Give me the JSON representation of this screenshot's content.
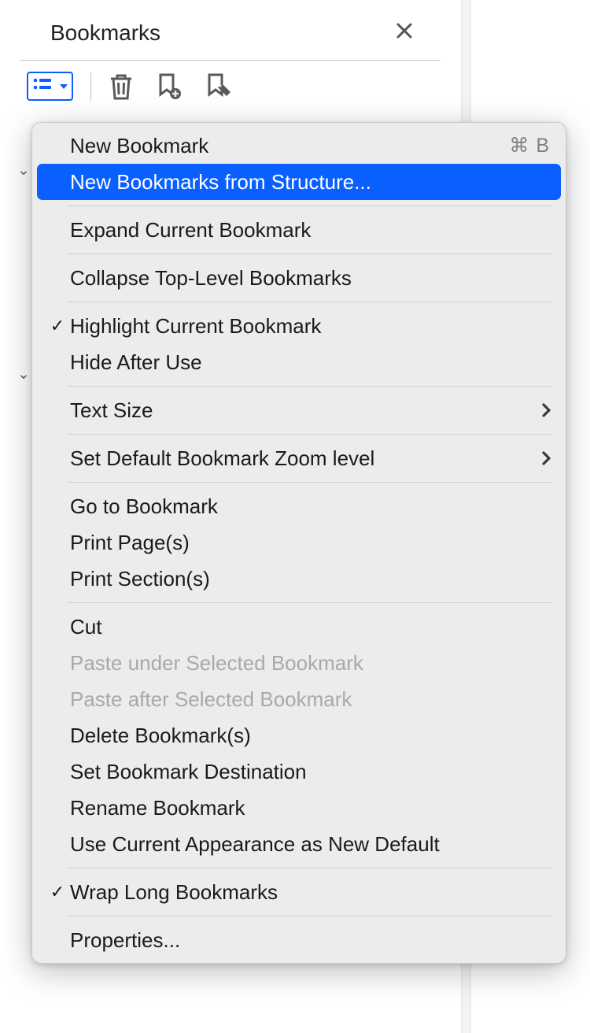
{
  "panel": {
    "title": "Bookmarks"
  },
  "menu": {
    "new_bookmark": {
      "label": "New Bookmark",
      "shortcut": "⌘ B"
    },
    "new_from_structure": {
      "label": "New Bookmarks from Structure..."
    },
    "expand_current": {
      "label": "Expand Current Bookmark"
    },
    "collapse_top": {
      "label": "Collapse Top-Level Bookmarks"
    },
    "highlight_current": {
      "label": "Highlight Current Bookmark"
    },
    "hide_after_use": {
      "label": "Hide After Use"
    },
    "text_size": {
      "label": "Text Size"
    },
    "set_default_zoom": {
      "label": "Set Default Bookmark Zoom level"
    },
    "go_to_bookmark": {
      "label": "Go to Bookmark"
    },
    "print_pages": {
      "label": "Print Page(s)"
    },
    "print_sections": {
      "label": "Print Section(s)"
    },
    "cut": {
      "label": "Cut"
    },
    "paste_under": {
      "label": "Paste under Selected Bookmark"
    },
    "paste_after": {
      "label": "Paste after Selected Bookmark"
    },
    "delete_bookmarks": {
      "label": "Delete Bookmark(s)"
    },
    "set_destination": {
      "label": "Set Bookmark Destination"
    },
    "rename": {
      "label": "Rename Bookmark"
    },
    "use_current_appearance": {
      "label": "Use Current Appearance as New Default"
    },
    "wrap_long": {
      "label": "Wrap Long Bookmarks"
    },
    "properties": {
      "label": "Properties..."
    }
  }
}
